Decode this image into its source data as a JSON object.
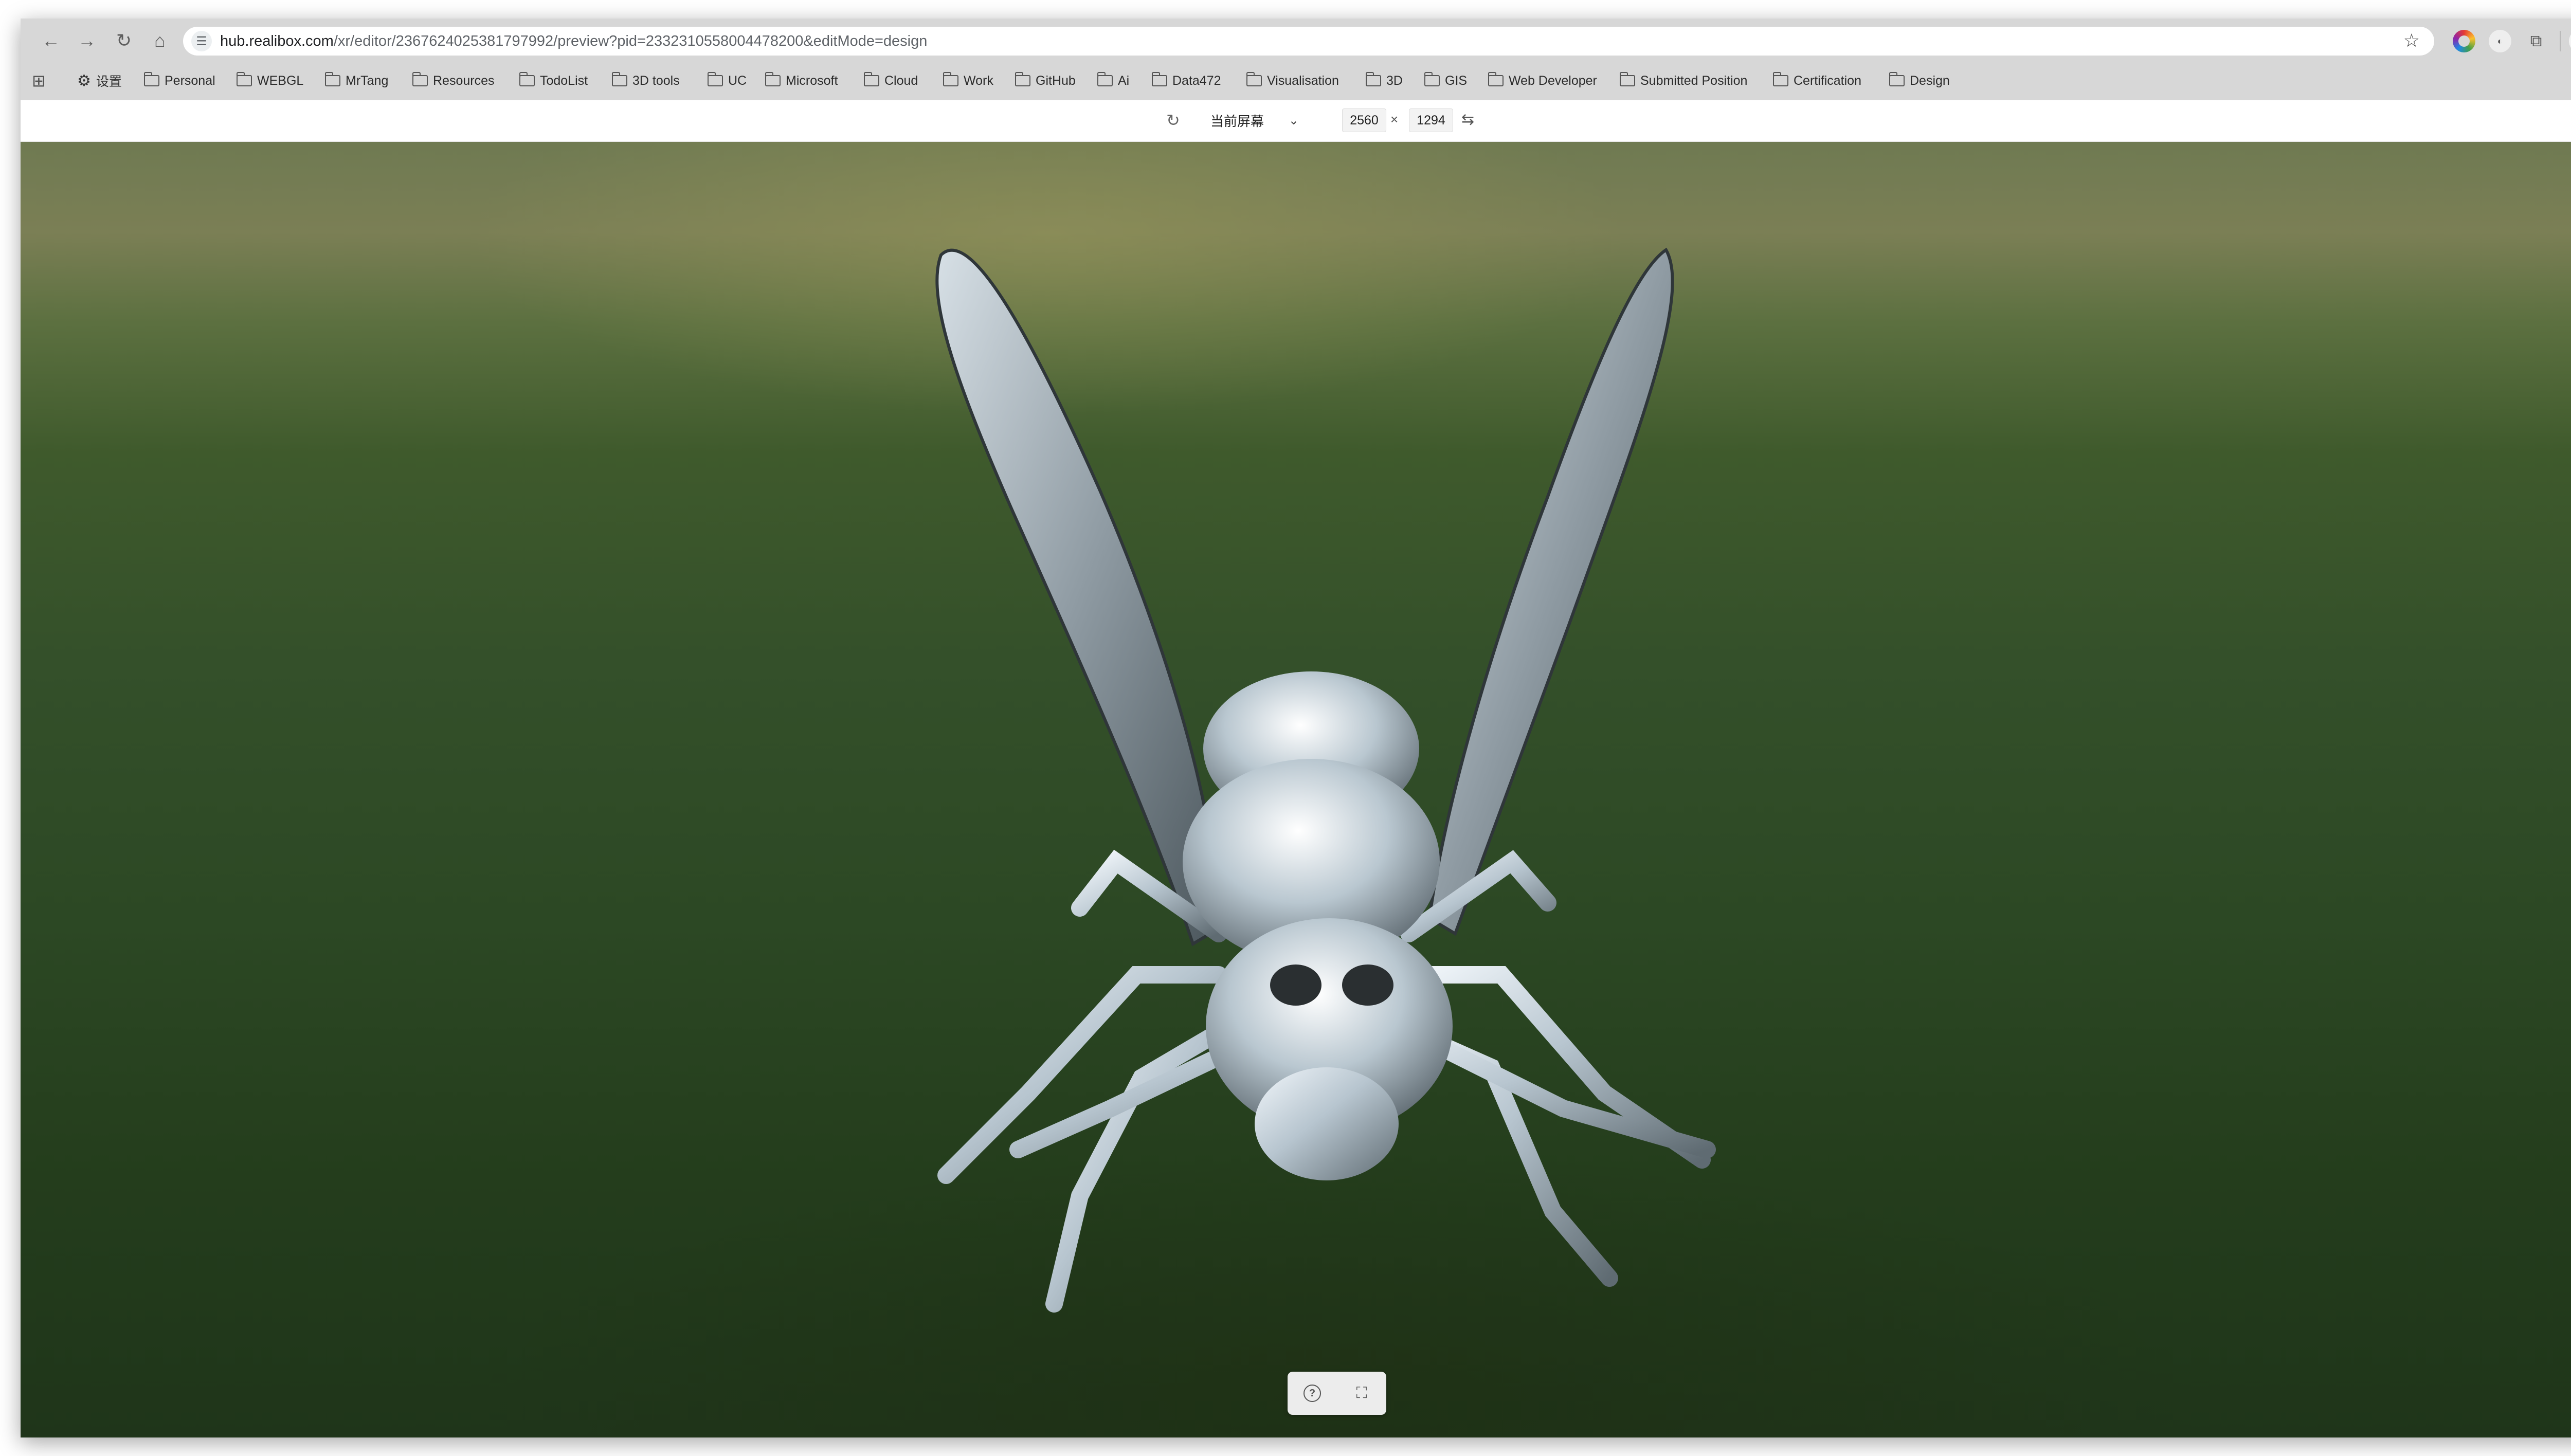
{
  "browser": {
    "url_host": "hub.realibox.com",
    "url_path": "/xr/editor/2367624025381797992/preview?pid=2332310558004478200&editMode=design",
    "icons": {
      "back": "arrow-left-icon",
      "forward": "arrow-right-icon",
      "reload": "reload-icon",
      "home": "home-icon",
      "site_info": "tune-icon",
      "bookmark_star": "star-icon",
      "extensions": "puzzle-icon",
      "profile": "profile-icon",
      "menu": "kebab-menu-icon"
    }
  },
  "bookmarks": {
    "settings_label": "设置",
    "items": [
      "Personal",
      "WEBGL",
      "MrTang",
      "Resources",
      "TodoList",
      "3D tools",
      "UC",
      "Microsoft",
      "Cloud",
      "Work",
      "GitHub",
      "Ai",
      "Data472",
      "Visualisation",
      "3D",
      "GIS",
      "Web Developer",
      "Submitted Position",
      "Certification",
      "Design"
    ]
  },
  "preview_toolbar": {
    "screen_mode": "当前屏幕",
    "width": "2560",
    "separator": "×",
    "height": "1294"
  },
  "scene": {
    "subject": "metallic silver bee 3D model",
    "background": "blurred grass field",
    "colors": {
      "grass_dark": "#243d1c",
      "grass_mid": "#3f5a2c",
      "horizon": "#7b7f55",
      "metal": "#c8d4dc"
    }
  },
  "viewer_controls": {
    "help_icon": "help-circle-icon",
    "fullscreen_icon": "fullscreen-icon"
  }
}
